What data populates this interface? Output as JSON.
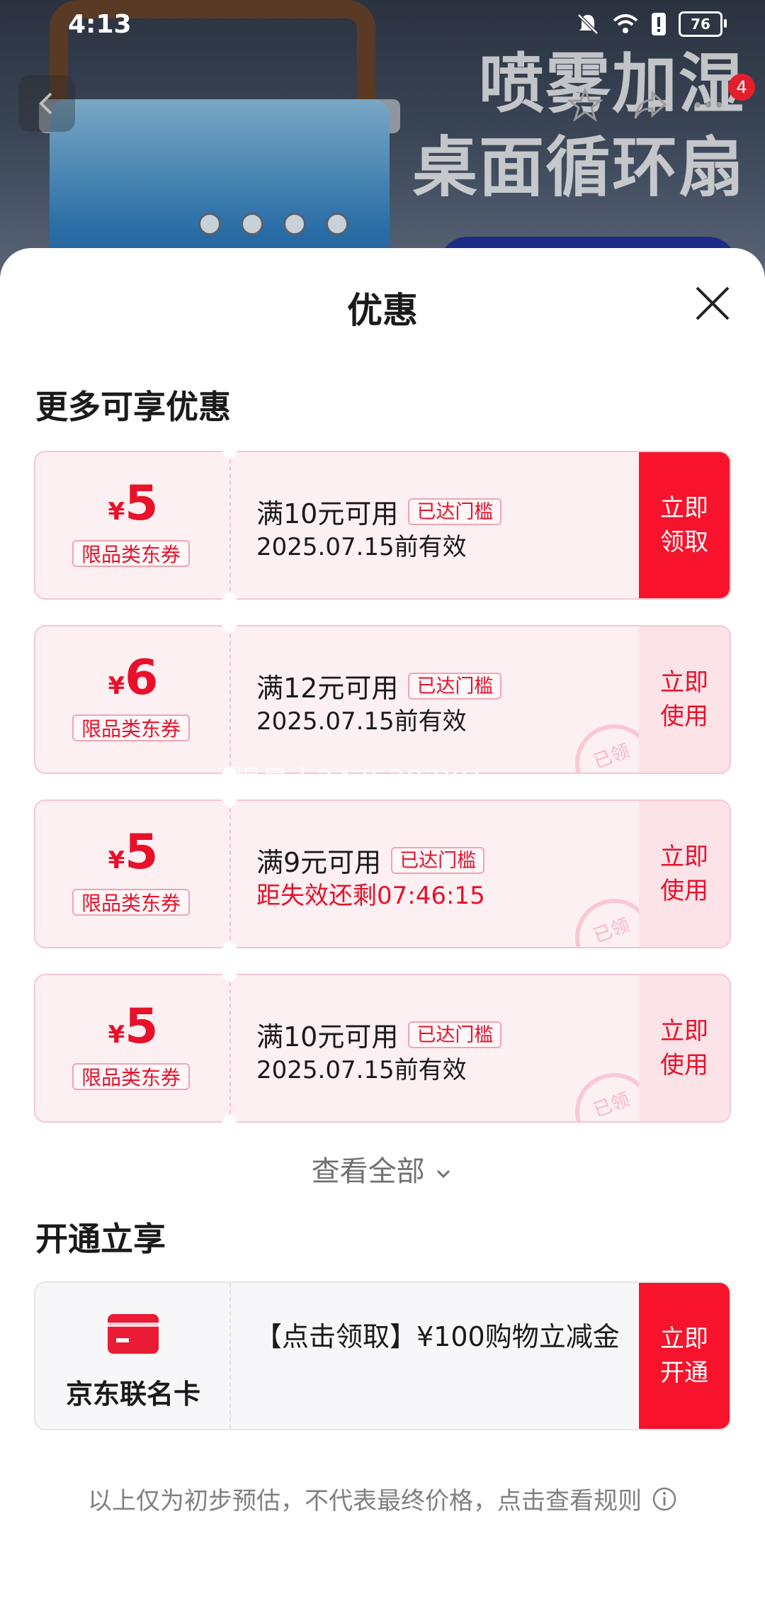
{
  "status_bar": {
    "time": "4:13",
    "battery": "76"
  },
  "hero": {
    "line1": "喷雾加湿",
    "line2": "桌面循环扇",
    "cart_count": "4"
  },
  "sheet": {
    "title": "优惠",
    "section_more": "更多可享优惠",
    "section_open": "开通立享",
    "view_all": "查看全部",
    "disclaimer": "以上仅为初步预估，不代表最终价格，点击查看规则"
  },
  "coupons": [
    {
      "currency": "¥",
      "amount": "5",
      "type": "限品类东券",
      "condition": "满10元可用",
      "badge": "已达门槛",
      "validity": "2025.07.15前有效",
      "action": "立即领取",
      "claimed": false
    },
    {
      "currency": "¥",
      "amount": "6",
      "type": "限品类东券",
      "condition": "满12元可用",
      "badge": "已达门槛",
      "validity": "2025.07.15前有效",
      "action": "立即使用",
      "claimed": true,
      "stamp": "已领"
    },
    {
      "currency": "¥",
      "amount": "5",
      "type": "限品类东券",
      "condition": "满9元可用",
      "badge": "已达门槛",
      "validity": "距失效还剩07:46:15",
      "action": "立即使用",
      "claimed": true,
      "stamp": "已领"
    },
    {
      "currency": "¥",
      "amount": "5",
      "type": "限品类东券",
      "condition": "满10元可用",
      "badge": "已达门槛",
      "validity": "2025.07.15前有效",
      "action": "立即使用",
      "claimed": true,
      "stamp": "已领"
    }
  ],
  "watermark": "慢星人2475387XU",
  "card_offer": {
    "name": "京东联名卡",
    "description": "【点击领取】¥100购物立减金",
    "action": "立即开通"
  },
  "colors": {
    "accent": "#f7132b",
    "coupon_bg": "#fdf0f2"
  }
}
